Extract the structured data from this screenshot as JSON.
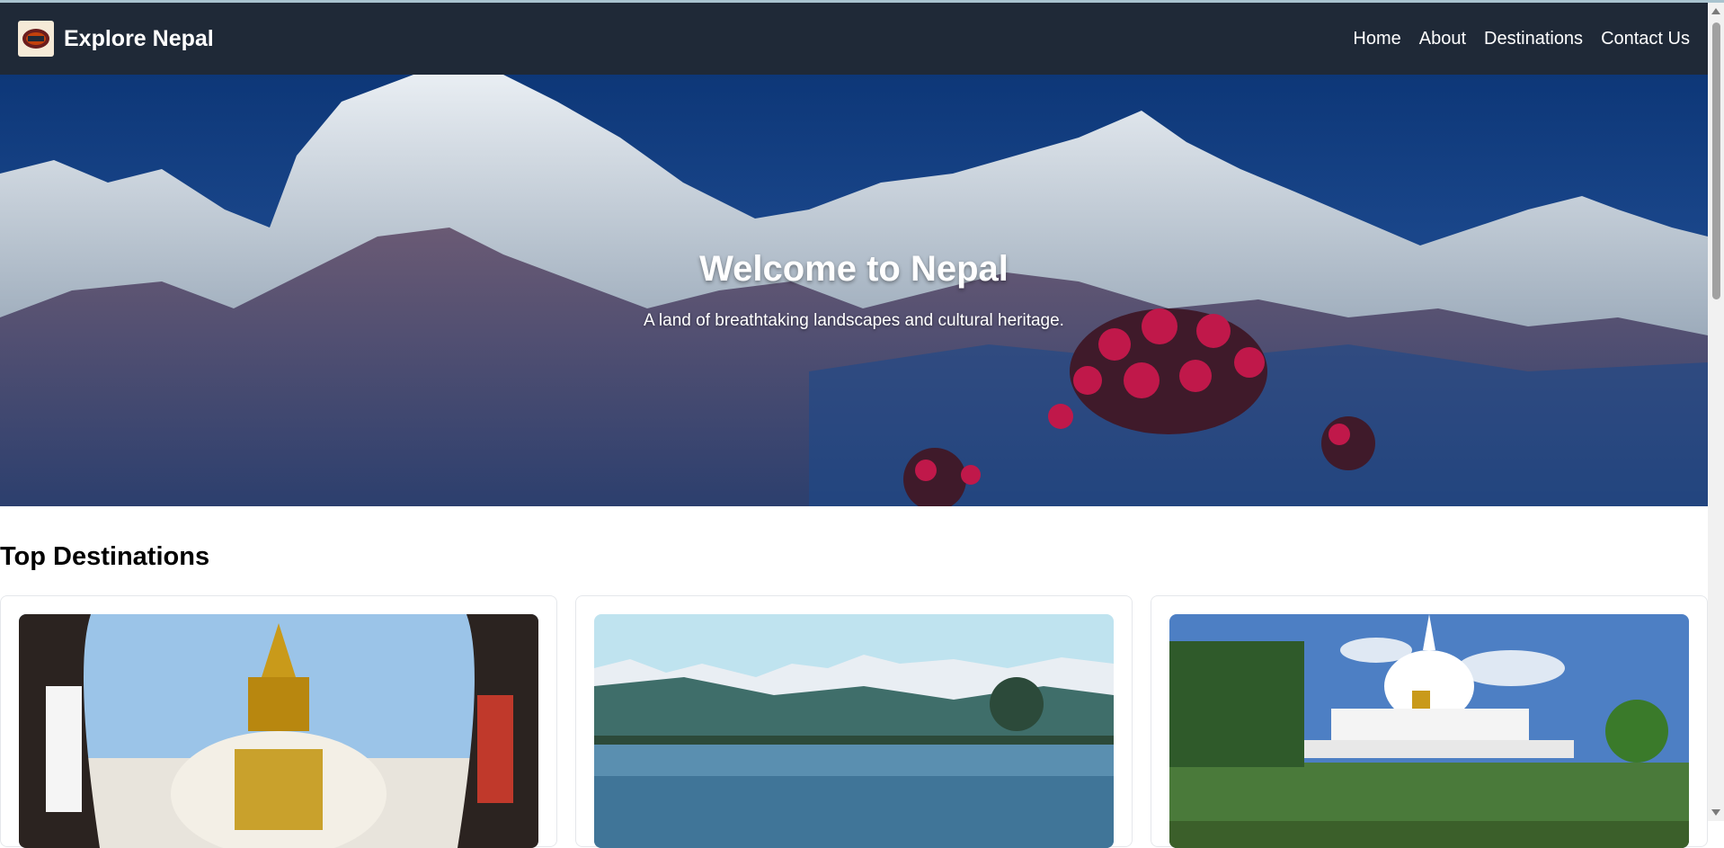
{
  "brand": {
    "name": "Explore Nepal",
    "logo_icon": "nepal-logo-icon"
  },
  "nav": {
    "items": [
      {
        "label": "Home"
      },
      {
        "label": "About"
      },
      {
        "label": "Destinations"
      },
      {
        "label": "Contact Us"
      }
    ]
  },
  "hero": {
    "title": "Welcome to Nepal",
    "subtitle": "A land of breathtaking landscapes and cultural heritage."
  },
  "destinations": {
    "heading": "Top Destinations",
    "cards": [
      {
        "image": "swayambhunath-stupa-image"
      },
      {
        "image": "phewa-lake-pokhara-image"
      },
      {
        "image": "world-peace-pagoda-image"
      }
    ]
  },
  "colors": {
    "navbar": "#1f2937",
    "text": "#ffffff",
    "accent": "#dc2626"
  }
}
